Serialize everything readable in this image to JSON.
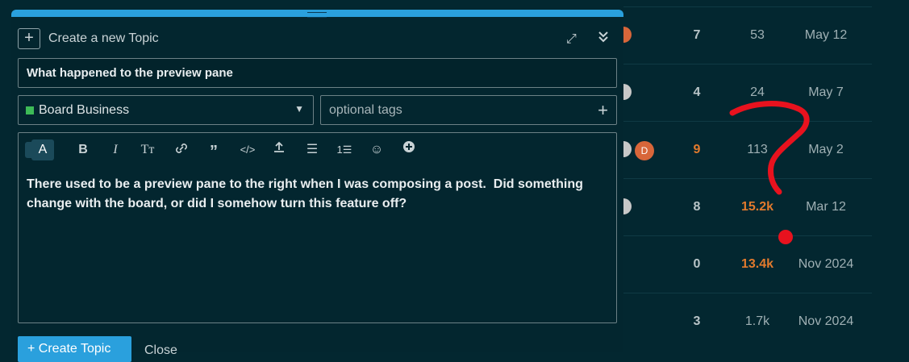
{
  "topic_list": {
    "rows": [
      {
        "replies": "7",
        "views": "53",
        "activity": "May 12",
        "replies_hot": false,
        "views_hot": false
      },
      {
        "replies": "4",
        "views": "24",
        "activity": "May 7",
        "replies_hot": false,
        "views_hot": false
      },
      {
        "replies": "9",
        "views": "113",
        "activity": "May 2",
        "replies_hot": true,
        "views_hot": false,
        "poster_initial": "D"
      },
      {
        "replies": "8",
        "views": "15.2k",
        "activity": "Mar 12",
        "replies_hot": false,
        "views_hot": true
      },
      {
        "replies": "0",
        "views": "13.4k",
        "activity": "Nov 2024",
        "replies_hot": false,
        "views_hot": true
      },
      {
        "replies": "3",
        "views": "1.7k",
        "activity": "Nov 2024",
        "replies_hot": false,
        "views_hot": false
      }
    ]
  },
  "composer": {
    "action_label": "Create a new Topic",
    "title_value": "What happened to the preview pane",
    "category_label": "Board Business",
    "category_color": "#3dbb57",
    "tags_placeholder": "optional tags",
    "toolbar": [
      "format-icon",
      "bold-icon",
      "italic-icon",
      "heading-icon",
      "link-icon",
      "quote-icon",
      "code-icon",
      "upload-icon",
      "bullet-list-icon",
      "numbered-list-icon",
      "emoji-icon",
      "add-icon"
    ],
    "body_text": "There used to be a preview pane to the right when I was composing a post.  Did something change with the board, or did I somehow turn this feature off?",
    "create_button": "+ Create Topic",
    "close_button": "Close"
  },
  "colors": {
    "accent": "#2aa0dd",
    "hot": "#e27a2d",
    "annotation": "#e8121e"
  }
}
